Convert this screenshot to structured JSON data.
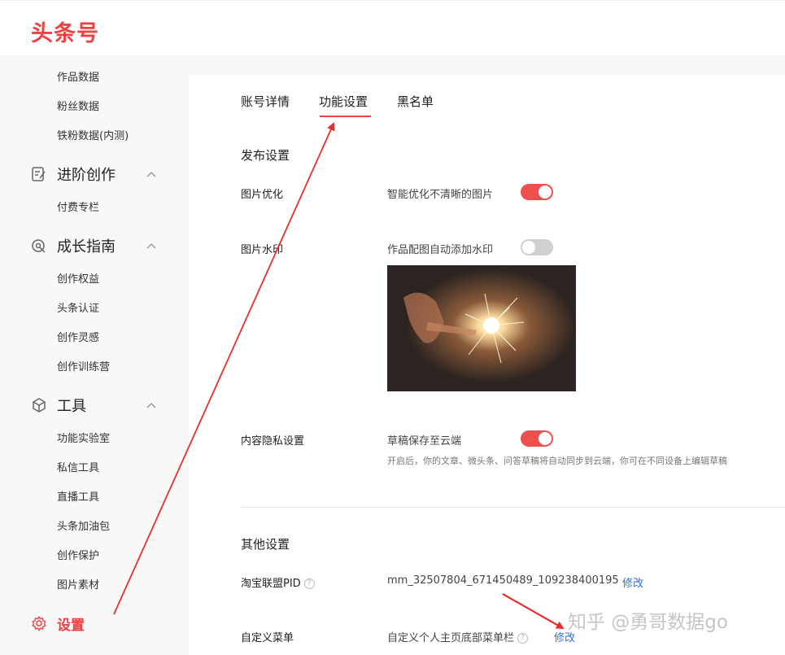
{
  "brand": {
    "logo": "头条号"
  },
  "sidebar": {
    "items_top": [
      "作品数据",
      "粉丝数据",
      "铁粉数据(内测)"
    ],
    "groups": [
      {
        "label": "进阶创作",
        "icon": "edit-icon",
        "items": [
          "付费专栏"
        ]
      },
      {
        "label": "成长指南",
        "icon": "growth-icon",
        "items": [
          "创作权益",
          "头条认证",
          "创作灵感",
          "创作训练营"
        ]
      },
      {
        "label": "工具",
        "icon": "cube-icon",
        "items": [
          "功能实验室",
          "私信工具",
          "直播工具",
          "头条加油包",
          "创作保护",
          "图片素材"
        ]
      }
    ],
    "settings": {
      "label": "设置",
      "icon": "gear-icon"
    }
  },
  "tabs": [
    {
      "label": "账号详情"
    },
    {
      "label": "功能设置",
      "active": true
    },
    {
      "label": "黑名单"
    }
  ],
  "publish": {
    "section_title": "发布设置",
    "image_opt": {
      "label": "图片优化",
      "desc": "智能优化不清晰的图片",
      "enabled": true
    },
    "watermark": {
      "label": "图片水印",
      "desc": "作品配图自动添加水印",
      "enabled": false
    },
    "privacy": {
      "label": "内容隐私设置",
      "desc": "草稿保存至云端",
      "enabled": true,
      "hint": "开启后，你的文章、微头条、问答草稿将自动同步到云端，你可在不同设备上编辑草稿"
    }
  },
  "other": {
    "section_title": "其他设置",
    "taobao": {
      "label": "淘宝联盟PID",
      "value": "mm_32507804_671450489_109238400195",
      "action": "修改"
    },
    "menu": {
      "label": "自定义菜单",
      "desc": "自定义个人主页底部菜单栏",
      "action": "修改"
    }
  },
  "watermark_text": "知乎 @勇哥数据go",
  "colors": {
    "accent": "#f04142",
    "link": "#2f6fd6",
    "toggle_on": "#f04f4f",
    "toggle_off": "#d0d0d0",
    "annotation_arrow": "#e53030"
  }
}
